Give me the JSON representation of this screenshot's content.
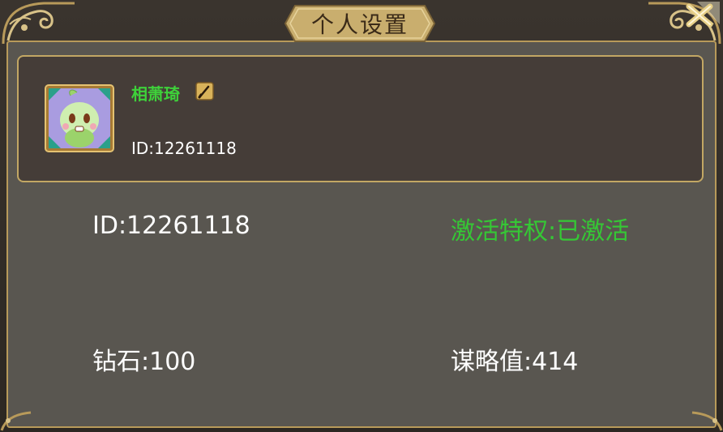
{
  "window": {
    "title": "个人设置"
  },
  "profile": {
    "name": "相萧琦",
    "id_label": "ID:12261118"
  },
  "stats": {
    "id": "ID:12261118",
    "privilege": "激活特权:已激活",
    "diamonds": "钻石:100",
    "strategy": "谋略值:414"
  },
  "icons": {
    "close": "close-x-icon",
    "edit": "brush-edit-icon",
    "avatar": "green-sprout-avatar"
  },
  "colors": {
    "gold": "#c2a764",
    "name_green": "#3ed13a",
    "privilege_green": "#35c835",
    "panel_bg": "#595650",
    "profile_bg": "#453d38"
  }
}
